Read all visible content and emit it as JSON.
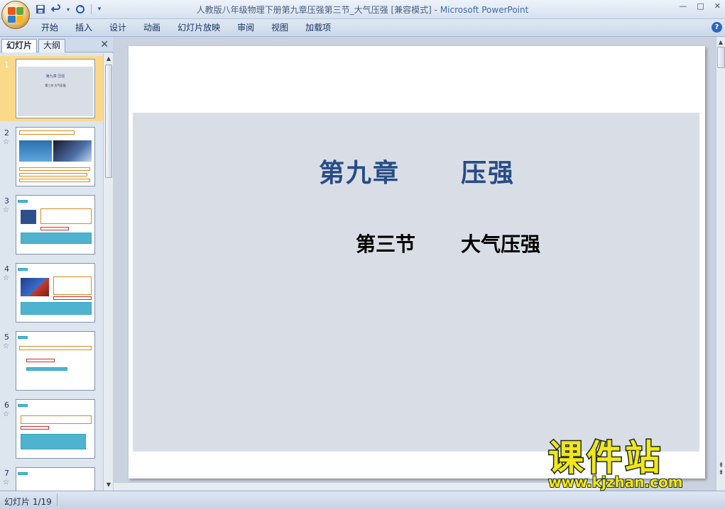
{
  "window": {
    "title": "人教版八年级物理下册第九章压强第三节_大气压强 [兼容模式]",
    "separator": " - ",
    "app_name": "Microsoft PowerPoint",
    "controls": [
      "—",
      "□",
      "✕"
    ]
  },
  "ribbon": {
    "tabs": [
      "开始",
      "插入",
      "设计",
      "动画",
      "幻灯片放映",
      "审阅",
      "视图",
      "加载项"
    ],
    "help": "?"
  },
  "left_pane": {
    "tabs": [
      "幻灯片",
      "大纲"
    ],
    "close": "✕",
    "slide_numbers": [
      "1",
      "2",
      "3",
      "4",
      "5",
      "6",
      "7"
    ],
    "thumb1": {
      "title": "第九章     压强",
      "subtitle": "第三节     大气压强"
    }
  },
  "slide": {
    "title_part1": "第九章",
    "title_part2": "压强",
    "subtitle_part1": "第三节",
    "subtitle_part2": "大气压强",
    "title_color": "#274c86"
  },
  "status": {
    "slide_counter": "幻灯片 1/19"
  },
  "watermark": {
    "brand": "课件站",
    "url": "www.kjzhan.com",
    "color": "#f3e61a"
  }
}
